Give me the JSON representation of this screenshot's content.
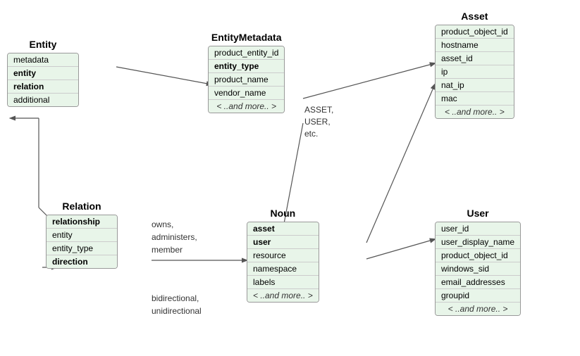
{
  "entity": {
    "title": "Entity",
    "rows": [
      "metadata",
      "entity",
      "relation",
      "additional"
    ]
  },
  "entityMetadata": {
    "title": "EntityMetadata",
    "rows": [
      "product_entity_id",
      "entity_type",
      "product_name",
      "vendor_name",
      "< ..and more.. >"
    ],
    "boldRows": [
      "entity_type"
    ]
  },
  "asset": {
    "title": "Asset",
    "rows": [
      "product_object_id",
      "hostname",
      "asset_id",
      "ip",
      "nat_ip",
      "mac",
      "< ..and more.. >"
    ]
  },
  "relation": {
    "title": "Relation",
    "rows": [
      "relationship",
      "entity",
      "entity_type",
      "direction"
    ],
    "boldRows": [
      "relationship",
      "direction"
    ]
  },
  "noun": {
    "title": "Noun",
    "rows": [
      "asset",
      "user",
      "resource",
      "namespace",
      "labels",
      "< ..and more.. >"
    ],
    "boldRows": [
      "asset",
      "user"
    ]
  },
  "user": {
    "title": "User",
    "rows": [
      "user_id",
      "user_display_name",
      "product_object_id",
      "windows_sid",
      "email_addresses",
      "groupid",
      "< ..and more.. >"
    ]
  },
  "labels": {
    "asset_user_etc": "ASSET,\nUSER,\netc.",
    "owns": "owns,\nadministers,\nmember",
    "bidirectional": "bidirectional,\nunidirectional"
  }
}
